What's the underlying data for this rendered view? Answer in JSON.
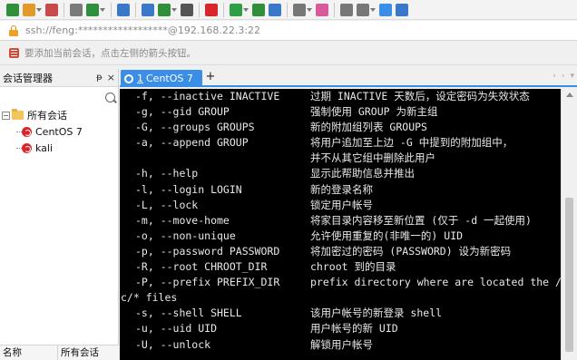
{
  "toolbar": {
    "icons": [
      "new-session-icon",
      "open-folder-icon",
      "link-icon",
      "unlink-icon",
      "reconnect-icon",
      "search-icon",
      "compose-icon",
      "globe-icon",
      "font-icon",
      "xshell-icon",
      "xftp-icon",
      "fullscreen-icon",
      "transfer-icon",
      "lock-icon",
      "highlight-icon",
      "keyboard-icon",
      "script-icon",
      "help-icon",
      "chat-icon"
    ],
    "colors": [
      "#2f8f3a",
      "#e29a2b",
      "#c94a4a",
      "#7a7a7a",
      "#2f8f3a",
      "#3a78c9",
      "#3a78c9",
      "#2f8f3a",
      "#555555",
      "#d8262b",
      "#2f9e44",
      "#2f8f3a",
      "#3a78c9",
      "#777777",
      "#d95a9a",
      "#777777",
      "#777777",
      "#3a8ee6",
      "#3a78c9"
    ]
  },
  "address": {
    "text": "ssh://feng:******************@192.168.22.3:22"
  },
  "hint": {
    "text": "要添加当前会话，点击左侧的箭头按钮。"
  },
  "session_panel": {
    "title": "会话管理器",
    "pin": "ᵽ",
    "close": "×",
    "root_folder": "所有会话",
    "sessions": [
      "CentOS 7",
      "kali"
    ],
    "columns": [
      "名称",
      "所有会话"
    ]
  },
  "tabs": {
    "active": {
      "number": "1",
      "label": "CentOS 7"
    },
    "add": "+",
    "nav": [
      "‹",
      "›",
      "▾"
    ]
  },
  "terminal": {
    "lines": [
      {
        "opt": "-f, --inactive INACTIVE",
        "desc": "过期 INACTIVE 天数后，设定密码为失效状态"
      },
      {
        "opt": "-g, --gid GROUP",
        "desc": "强制使用 GROUP 为新主组"
      },
      {
        "opt": "-G, --groups GROUPS",
        "desc": "新的附加组列表 GROUPS"
      },
      {
        "opt": "-a, --append GROUP",
        "desc": "将用户追加至上边 -G 中提到的附加组中，"
      },
      {
        "opt": "",
        "desc": "并不从其它组中删除此用户"
      },
      {
        "opt": "-h, --help",
        "desc": "显示此帮助信息并推出"
      },
      {
        "opt": "-l, --login LOGIN",
        "desc": "新的登录名称"
      },
      {
        "opt": "-L, --lock",
        "desc": "锁定用户帐号"
      },
      {
        "opt": "-m, --move-home",
        "desc": "将家目录内容移至新位置 (仅于 -d 一起使用)"
      },
      {
        "opt": "-o, --non-unique",
        "desc": "允许使用重复的(非唯一的) UID"
      },
      {
        "opt": "-p, --password PASSWORD",
        "desc": "将加密过的密码 (PASSWORD) 设为新密码"
      },
      {
        "opt": "-R, --root CHROOT_DIR",
        "desc": "chroot 到的目录"
      },
      {
        "opt": "-P, --prefix PREFIX_DIR",
        "desc": "prefix directory where are located the /et"
      },
      {
        "opt": "c/* files",
        "desc": "",
        "cont": true
      },
      {
        "opt": "-s, --shell SHELL",
        "desc": "该用户帐号的新登录 shell"
      },
      {
        "opt": "-u, --uid UID",
        "desc": "用户帐号的新 UID"
      },
      {
        "opt": "-U, --unlock",
        "desc": "解锁用户帐号"
      }
    ]
  }
}
